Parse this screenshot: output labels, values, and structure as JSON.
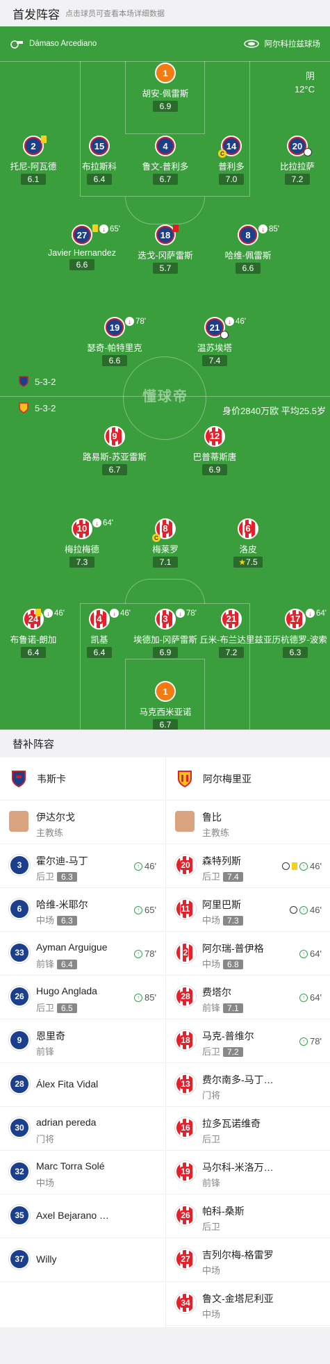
{
  "header": {
    "title": "首发阵容",
    "subtitle": "点击球员可查看本场详细数据"
  },
  "match_info": {
    "referee": "Dámaso Arcediano",
    "stadium": "阿尔科拉兹球场",
    "weather": "阴",
    "temperature": "12°C"
  },
  "home": {
    "formation": "5-3-2",
    "players": [
      {
        "num": "1",
        "name": "胡安-佩雷斯",
        "rating": "6.9"
      },
      {
        "num": "2",
        "name": "托尼-阿瓦德",
        "rating": "6.1"
      },
      {
        "num": "15",
        "name": "布拉斯科",
        "rating": "6.4"
      },
      {
        "num": "4",
        "name": "鲁文-普利多",
        "rating": "6.7"
      },
      {
        "num": "14",
        "name": "普利多",
        "rating": "7.0"
      },
      {
        "num": "20",
        "name": "比拉拉萨",
        "rating": "7.2"
      },
      {
        "num": "27",
        "name": "Javier Hernandez",
        "rating": "6.6",
        "sub": "65'"
      },
      {
        "num": "18",
        "name": "迭戈-冈萨雷斯",
        "rating": "5.7"
      },
      {
        "num": "8",
        "name": "哈维-佩雷斯",
        "rating": "6.6",
        "sub": "85'"
      },
      {
        "num": "19",
        "name": "瑟奇-帕特里克",
        "rating": "6.6",
        "sub": "78'"
      },
      {
        "num": "21",
        "name": "温苏埃塔",
        "rating": "7.4",
        "sub": "46'"
      }
    ]
  },
  "away": {
    "formation": "5-3-2",
    "value_text": "身价2840万欧 平均25.5岁",
    "players": [
      {
        "num": "9",
        "name": "路易斯-苏亚雷斯",
        "rating": "6.7"
      },
      {
        "num": "12",
        "name": "巴普蒂斯唐",
        "rating": "6.9"
      },
      {
        "num": "10",
        "name": "梅拉梅德",
        "rating": "7.3",
        "sub": "64'"
      },
      {
        "num": "8",
        "name": "梅莱罗",
        "rating": "7.1"
      },
      {
        "num": "6",
        "name": "洛皮",
        "rating": "7.5"
      },
      {
        "num": "24",
        "name": "布鲁诺-朗加",
        "rating": "6.4",
        "sub": "46'"
      },
      {
        "num": "4",
        "name": "凯基",
        "rating": "6.4",
        "sub": "46'"
      },
      {
        "num": "3",
        "name": "埃德加-冈萨雷斯",
        "rating": "6.9",
        "sub": "78'"
      },
      {
        "num": "21",
        "name": "丘米-布兰达里兹",
        "rating": "7.2"
      },
      {
        "num": "17",
        "name": "亚历杭德罗-波索",
        "rating": "6.3",
        "sub": "64'"
      },
      {
        "num": "1",
        "name": "马克西米亚诺",
        "rating": "6.7"
      }
    ]
  },
  "watermark": "懂球帝",
  "bench": {
    "title": "替补阵容",
    "home_team": "韦斯卡",
    "away_team": "阿尔梅里亚",
    "home_coach": {
      "name": "伊达尔戈",
      "role": "主教练"
    },
    "away_coach": {
      "name": "鲁比",
      "role": "主教练"
    },
    "home_subs": [
      {
        "num": "3",
        "name": "霍尔迪-马丁",
        "pos": "后卫",
        "rating": "6.3",
        "time": "46'"
      },
      {
        "num": "6",
        "name": "哈维-米耶尔",
        "pos": "中场",
        "rating": "6.3",
        "time": "65'"
      },
      {
        "num": "33",
        "name": "Ayman Arguigue",
        "pos": "前锋",
        "rating": "6.4",
        "time": "78'"
      },
      {
        "num": "26",
        "name": "Hugo Anglada",
        "pos": "后卫",
        "rating": "6.5",
        "time": "85'"
      },
      {
        "num": "9",
        "name": "恩里奇",
        "pos": "前锋",
        "rating": "",
        "time": ""
      },
      {
        "num": "28",
        "name": "Álex Fita Vidal",
        "pos": "",
        "rating": "",
        "time": ""
      },
      {
        "num": "30",
        "name": "adrian pereda",
        "pos": "门将",
        "rating": "",
        "time": ""
      },
      {
        "num": "32",
        "name": "Marc Torra Solé",
        "pos": "中场",
        "rating": "",
        "time": ""
      },
      {
        "num": "35",
        "name": "Axel Bejarano Torres",
        "pos": "",
        "rating": "",
        "time": ""
      },
      {
        "num": "37",
        "name": "Willy",
        "pos": "",
        "rating": "",
        "time": ""
      }
    ],
    "away_subs": [
      {
        "num": "20",
        "name": "森特列斯",
        "pos": "后卫",
        "rating": "7.4",
        "time": "46'"
      },
      {
        "num": "11",
        "name": "阿里巴斯",
        "pos": "中场",
        "rating": "7.3",
        "time": "46'"
      },
      {
        "num": "2",
        "name": "阿尔瑞-普伊格",
        "pos": "中场",
        "rating": "6.8",
        "time": "64'"
      },
      {
        "num": "28",
        "name": "费塔尔",
        "pos": "前锋",
        "rating": "7.1",
        "time": "64'"
      },
      {
        "num": "18",
        "name": "马克-普维尔",
        "pos": "后卫",
        "rating": "7.2",
        "time": "78'"
      },
      {
        "num": "13",
        "name": "费尔南多-马丁内斯",
        "pos": "门将",
        "rating": "",
        "time": ""
      },
      {
        "num": "16",
        "name": "拉多瓦诺维奇",
        "pos": "后卫",
        "rating": "",
        "time": ""
      },
      {
        "num": "19",
        "name": "马尔科-米洛万诺维奇",
        "pos": "前锋",
        "rating": "",
        "time": ""
      },
      {
        "num": "26",
        "name": "帕科-桑斯",
        "pos": "后卫",
        "rating": "",
        "time": ""
      },
      {
        "num": "27",
        "name": "吉列尔梅-格雷罗",
        "pos": "中场",
        "rating": "",
        "time": ""
      },
      {
        "num": "34",
        "name": "鲁文-金塔尼利亚",
        "pos": "中场",
        "rating": "",
        "time": ""
      }
    ]
  },
  "colors": {
    "pitch": "#3a9e3c",
    "home_primary": "#1b3f8c",
    "home_trim": "#c8202a",
    "away_stripe": "#e4202a",
    "goalkeeper": "#f27b12"
  }
}
